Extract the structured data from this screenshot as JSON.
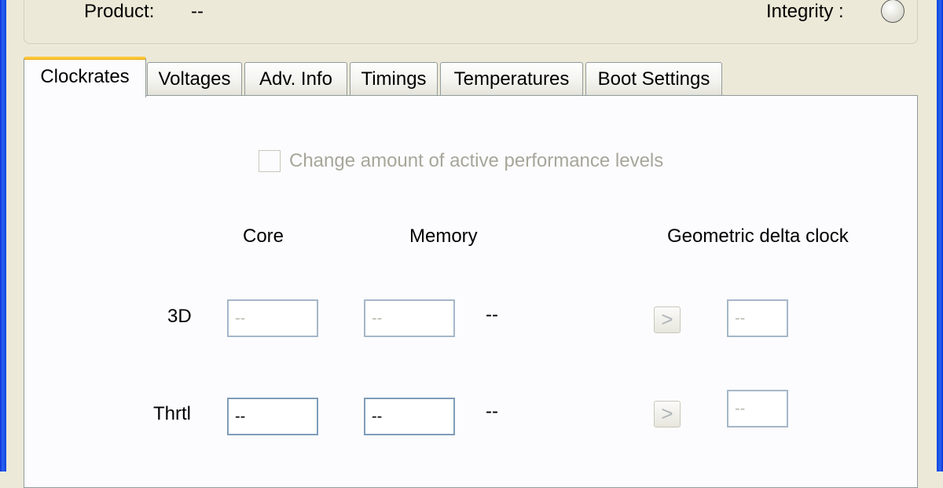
{
  "info": {
    "product_label": "Product:",
    "product_value": "--",
    "integrity_label": "Integrity :"
  },
  "tabs": [
    {
      "label": "Clockrates",
      "active": true
    },
    {
      "label": "Voltages"
    },
    {
      "label": "Adv. Info"
    },
    {
      "label": "Timings"
    },
    {
      "label": "Temperatures"
    },
    {
      "label": "Boot Settings"
    }
  ],
  "clockrates": {
    "perf_levels_checkbox_label": "Change amount of active performance levels",
    "perf_levels_checked": false,
    "headers": {
      "core": "Core",
      "memory": "Memory",
      "geometric": "Geometric delta clock"
    },
    "rows": [
      {
        "label": "3D",
        "core": "--",
        "memory": "--",
        "extra": "--",
        "geometric": "--",
        "arrow": ">"
      },
      {
        "label": "Thrtl",
        "core": "--",
        "memory": "--",
        "extra": "--",
        "geometric": "--",
        "arrow": ">"
      }
    ]
  },
  "colors": {
    "window_bg": "#ece9d8",
    "panel_bg": "#fcfcfe",
    "tab_highlight": "#ffc83c",
    "field_border": "#7f9db9",
    "frame_blue": "#0a46e0"
  }
}
